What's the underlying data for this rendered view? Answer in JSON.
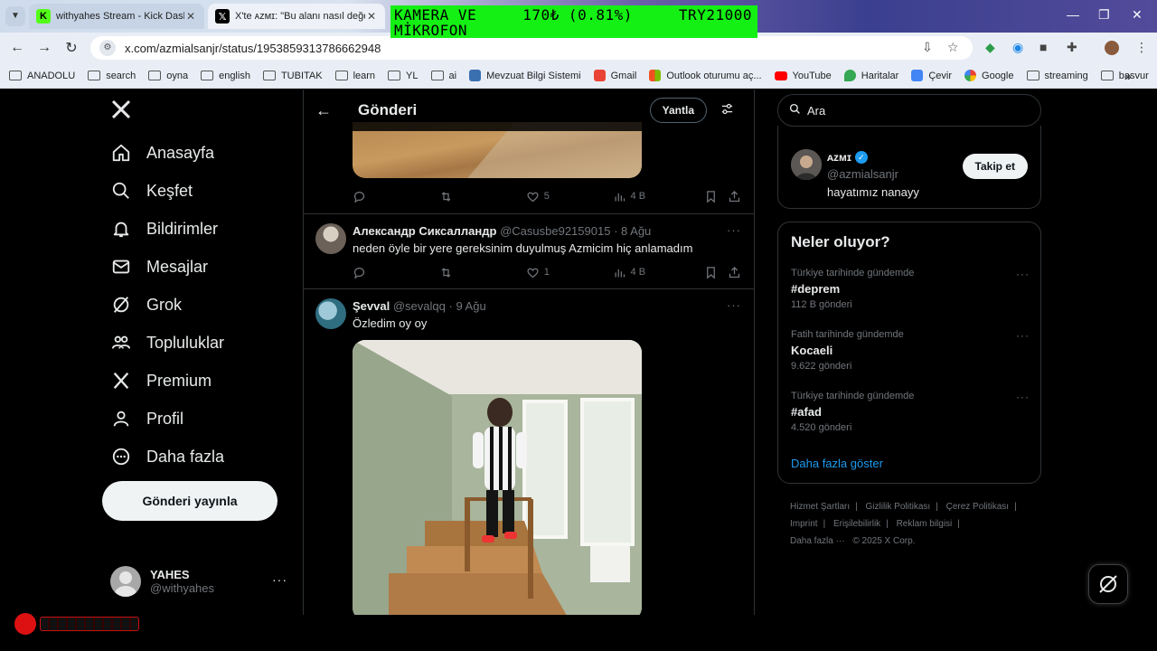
{
  "browser": {
    "tabs": [
      {
        "title": "withyahes Stream - Kick Dashb",
        "close": "✕"
      },
      {
        "title": "X'te ᴀᴢᴍɪ: \"Bu alanı nasıl değerl",
        "close": "✕"
      }
    ],
    "url": "x.com/azmialsanjr/status/1953859313786662948",
    "bookmarks": [
      {
        "label": "ANADOLU",
        "icon": "folder-icon"
      },
      {
        "label": "search",
        "icon": "folder-icon"
      },
      {
        "label": "oyna",
        "icon": "folder-icon"
      },
      {
        "label": "english",
        "icon": "folder-icon"
      },
      {
        "label": "TUBITAK",
        "icon": "folder-icon"
      },
      {
        "label": "learn",
        "icon": "folder-icon"
      },
      {
        "label": "YL",
        "icon": "folder-icon"
      },
      {
        "label": "ai",
        "icon": "folder-icon"
      },
      {
        "label": "Mevzuat Bilgi Sistemi",
        "icon": "mevzuat-icon"
      },
      {
        "label": "Gmail",
        "icon": "gmail-icon"
      },
      {
        "label": "Outlook oturumu aç...",
        "icon": "outlook-icon"
      },
      {
        "label": "YouTube",
        "icon": "youtube-icon"
      },
      {
        "label": "Haritalar",
        "icon": "maps-icon"
      },
      {
        "label": "Çevir",
        "icon": "translate-icon"
      },
      {
        "label": "Google",
        "icon": "google-icon"
      },
      {
        "label": "streaming",
        "icon": "folder-icon"
      },
      {
        "label": "basvur",
        "icon": "folder-icon"
      }
    ],
    "more_bookmarks": "»"
  },
  "stream_overlay": {
    "line1_left": "KAMERA VE",
    "line1_mid": "170₺ (0.81%)",
    "line1_right": "TRY21000",
    "line2": "MİKROFON"
  },
  "nav": {
    "items": [
      {
        "label": "Anasayfa",
        "icon": "home-icon"
      },
      {
        "label": "Keşfet",
        "icon": "search-icon"
      },
      {
        "label": "Bildirimler",
        "icon": "bell-icon"
      },
      {
        "label": "Mesajlar",
        "icon": "mail-icon"
      },
      {
        "label": "Grok",
        "icon": "grok-icon"
      },
      {
        "label": "Topluluklar",
        "icon": "communities-icon"
      },
      {
        "label": "Premium",
        "icon": "x-icon"
      },
      {
        "label": "Profil",
        "icon": "profile-icon"
      },
      {
        "label": "Daha fazla",
        "icon": "more-circle-icon"
      }
    ],
    "post_button": "Gönderi yayınla",
    "account": {
      "name": "YAHES",
      "handle": "@withyahes",
      "more": "···"
    }
  },
  "main": {
    "header_title": "Gönderi",
    "reply_button": "Yantla",
    "first_actions": {
      "likes": "5",
      "views": "4 B"
    },
    "tweets": [
      {
        "name": "Александр Сиксалландр",
        "handle": "@Casusbe92159015",
        "date": "8 Ağu",
        "text": "neden öyle bir yere gereksinim duyulmuş Azmicim hiç anlamadım",
        "likes": "1",
        "views": "4 B"
      },
      {
        "name": "Şevval",
        "handle": "@sevalqq",
        "date": "9 Ağu",
        "text": "Özledim oy oy"
      }
    ]
  },
  "right": {
    "search_placeholder": "Ara",
    "who_to_follow": {
      "name": "ᴀᴢᴍɪ",
      "handle": "@azmialsanjr",
      "bio": "hayatımız nanayy",
      "button": "Takip et"
    },
    "trends_title": "Neler oluyor?",
    "trends": [
      {
        "context": "Türkiye tarihinde gündemde",
        "name": "#deprem",
        "count": "112 B gönderi"
      },
      {
        "context": "Fatih tarihinde gündemde",
        "name": "Kocaeli",
        "count": "9.622 gönderi"
      },
      {
        "context": "Türkiye tarihinde gündemde",
        "name": "#afad",
        "count": "4.520 gönderi"
      }
    ],
    "show_more": "Daha fazla göster",
    "footer": {
      "links": [
        "Hizmet Şartları",
        "|",
        "Gizlilik Politikası",
        "|",
        "Çerez Politikası",
        "|",
        "Imprint",
        "|",
        "Erişilebilirlik",
        "|",
        "Reklam bilgisi",
        "|",
        "Daha fazla ···"
      ],
      "copyright": "© 2025 X Corp."
    }
  },
  "colors": {
    "accent": "#1d9bf0",
    "overlay_green": "#14f014",
    "background": "#000000"
  }
}
